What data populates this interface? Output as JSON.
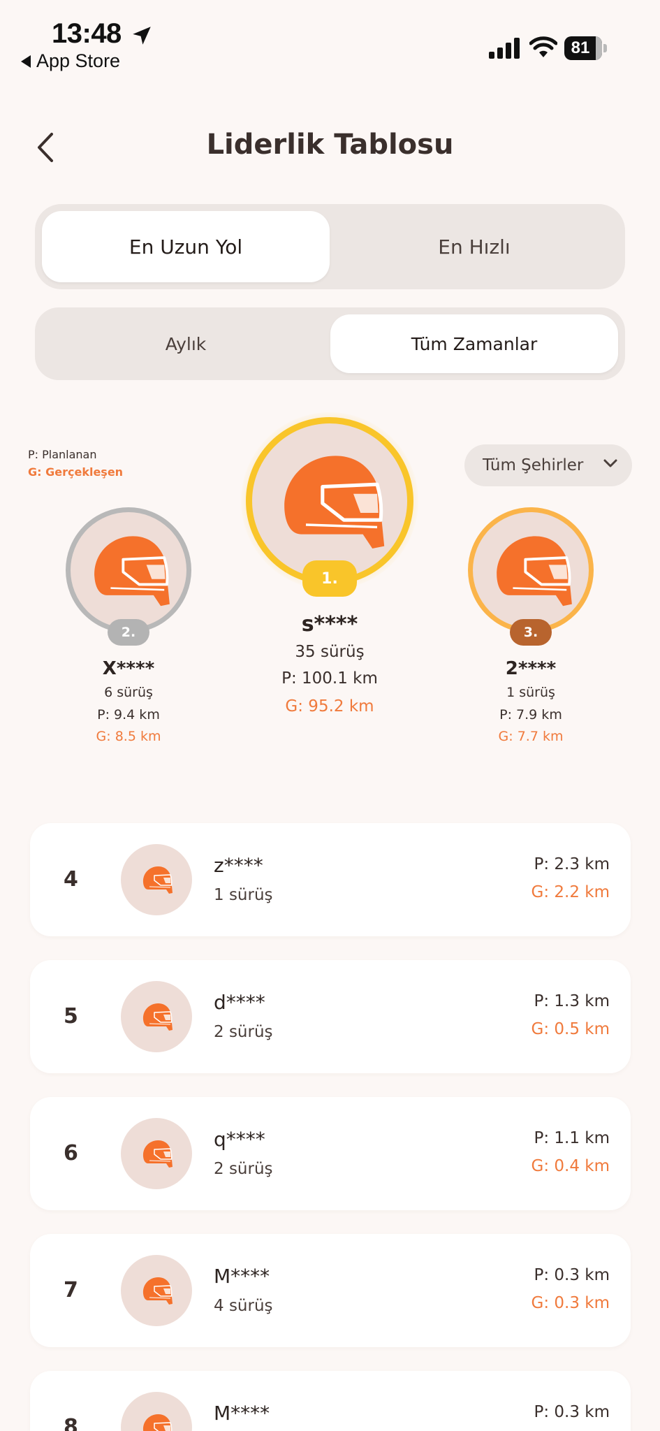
{
  "status_bar": {
    "time": "13:48",
    "back_app": "App Store",
    "battery": "81"
  },
  "header": {
    "title": "Liderlik Tablosu"
  },
  "tabs_type": [
    {
      "label": "En Uzun Yol",
      "active": true
    },
    {
      "label": "En Hızlı",
      "active": false
    }
  ],
  "tabs_period": [
    {
      "label": "Aylık",
      "active": false
    },
    {
      "label": "Tüm Zamanlar",
      "active": true
    }
  ],
  "legend": {
    "planned": "P: Planlanan",
    "actual": "G: Gerçekleşen"
  },
  "city_filter": {
    "label": "Tüm Şehirler"
  },
  "colors": {
    "accent": "#f07a3c",
    "gold": "#f9c52a",
    "silver": "#b8b8b8",
    "bronze": "#b8642e"
  },
  "podium": {
    "first": {
      "rank": "1.",
      "name": "s****",
      "rides": "35 sürüş",
      "planned": "P: 100.1 km",
      "actual": "G: 95.2 km"
    },
    "second": {
      "rank": "2.",
      "name": "X****",
      "rides": "6 sürüş",
      "planned": "P: 9.4 km",
      "actual": "G: 8.5 km"
    },
    "third": {
      "rank": "3.",
      "name": "2****",
      "rides": "1 sürüş",
      "planned": "P: 7.9 km",
      "actual": "G: 7.7 km"
    }
  },
  "list": [
    {
      "rank": "4",
      "name": "z****",
      "rides": "1 sürüş",
      "planned": "P: 2.3 km",
      "actual": "G: 2.2 km"
    },
    {
      "rank": "5",
      "name": "d****",
      "rides": "2 sürüş",
      "planned": "P: 1.3 km",
      "actual": "G: 0.5 km"
    },
    {
      "rank": "6",
      "name": "q****",
      "rides": "2 sürüş",
      "planned": "P: 1.1 km",
      "actual": "G: 0.4 km"
    },
    {
      "rank": "7",
      "name": "M****",
      "rides": "4 sürüş",
      "planned": "P: 0.3 km",
      "actual": "G: 0.3 km"
    },
    {
      "rank": "8",
      "name": "M****",
      "rides": "",
      "planned": "P: 0.3 km",
      "actual": ""
    }
  ]
}
